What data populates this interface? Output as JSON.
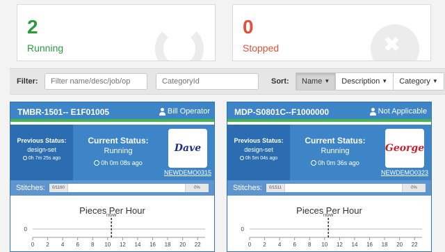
{
  "summary": {
    "running": {
      "count": "2",
      "label": "Running"
    },
    "stopped": {
      "count": "0",
      "label": "Stopped"
    }
  },
  "filter": {
    "label": "Filter:",
    "name_placeholder": "Filter name/desc/job/op",
    "category_placeholder": "CategoryId"
  },
  "sort": {
    "label": "Sort:",
    "options": [
      "Name",
      "Description",
      "Category"
    ],
    "active": "Name"
  },
  "colors": {
    "running": "#2e9a3f",
    "stopped": "#e05339",
    "card_header": "#3d85c6",
    "status_bar": "#43b649"
  },
  "machines": [
    {
      "title": "TMBR-1501-- E1F01005",
      "user": "Bill Operator",
      "prev_label": "Previous Status:",
      "prev_value": "design-set",
      "prev_ago": "0h 7m 25s ago",
      "cur_label": "Current Status:",
      "cur_value": "Running",
      "cur_ago": "0h 0m 08s ago",
      "avatar_text": "Dave",
      "avatar_link": "NEWDEMO0315",
      "stitches_label": "Stitches:",
      "stitches_count": "0/1160",
      "stitches_pct": "0%",
      "pph_title": "Pieces Per Hour"
    },
    {
      "title": "MDP-S0801C--F1000000",
      "user": "Not Applicable",
      "prev_label": "Previous Status:",
      "prev_value": "design-set",
      "prev_ago": "0h 5m 04s ago",
      "cur_label": "Current Status:",
      "cur_value": "Running",
      "cur_ago": "0h 0m 36s ago",
      "avatar_text": "George",
      "avatar_link": "NEWDEMO0323",
      "stitches_label": "Stitches:",
      "stitches_count": "0/1511",
      "stitches_pct": "0%",
      "pph_title": "Pieces Per Hour"
    }
  ],
  "chart_data": [
    {
      "type": "line",
      "title": "Pieces Per Hour",
      "x_ticks": [
        "0",
        "2",
        "4",
        "6",
        "8",
        "10",
        "12",
        "14",
        "16",
        "18",
        "20",
        "22"
      ],
      "xlim": [
        0,
        23
      ],
      "y_ticks": [
        "0"
      ],
      "now_label": "now",
      "now_x": 10.5,
      "series": [
        {
          "values": []
        }
      ]
    },
    {
      "type": "line",
      "title": "Pieces Per Hour",
      "x_ticks": [
        "0",
        "2",
        "4",
        "6",
        "8",
        "10",
        "12",
        "14",
        "16",
        "18",
        "20",
        "22"
      ],
      "xlim": [
        0,
        23
      ],
      "y_ticks": [
        "0"
      ],
      "now_label": "now",
      "now_x": 10.5,
      "series": [
        {
          "values": []
        }
      ]
    }
  ]
}
